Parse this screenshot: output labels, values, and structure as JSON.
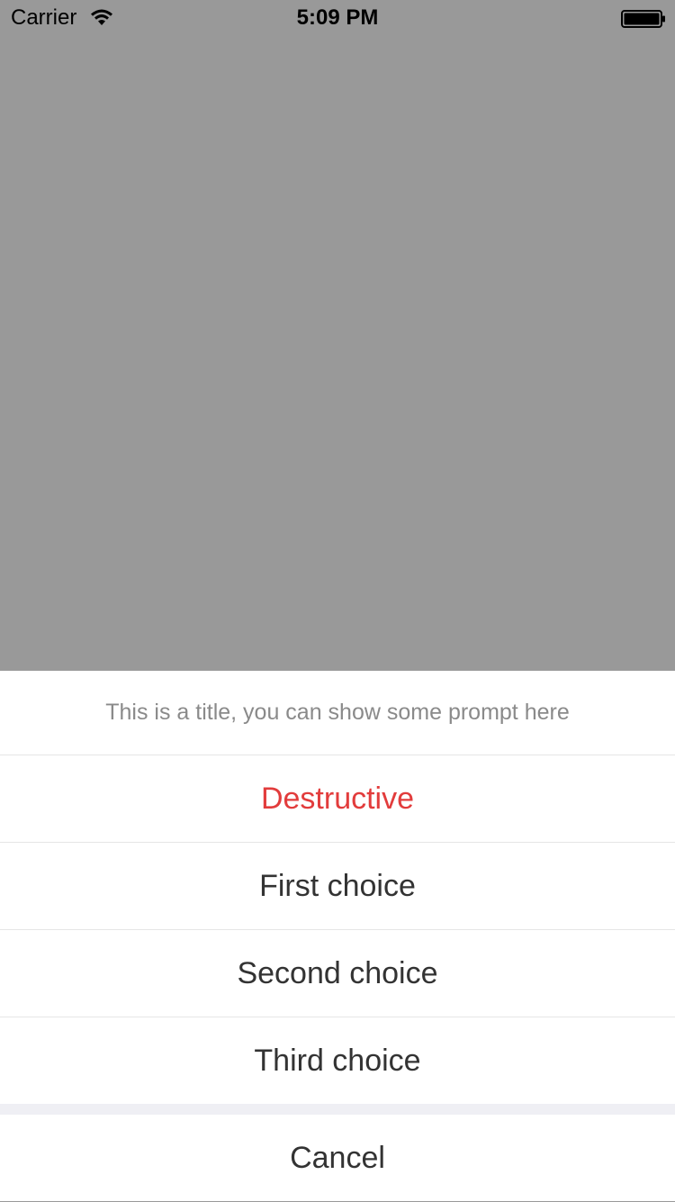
{
  "status_bar": {
    "carrier": "Carrier",
    "time": "5:09 PM",
    "wifi_icon": "wifi-icon",
    "battery_icon": "battery-icon"
  },
  "action_sheet": {
    "title": "This is a title, you can show some prompt here",
    "options": [
      {
        "label": "Destructive",
        "style": "destructive",
        "color": "#e23c3c"
      },
      {
        "label": "First choice",
        "style": "default"
      },
      {
        "label": "Second choice",
        "style": "default"
      },
      {
        "label": "Third choice",
        "style": "default"
      }
    ],
    "cancel_label": "Cancel"
  },
  "colors": {
    "overlay": "#999999",
    "sheet_background": "#ffffff",
    "destructive": "#e23c3c",
    "text": "#333333",
    "title_text": "#8a8a8a"
  }
}
